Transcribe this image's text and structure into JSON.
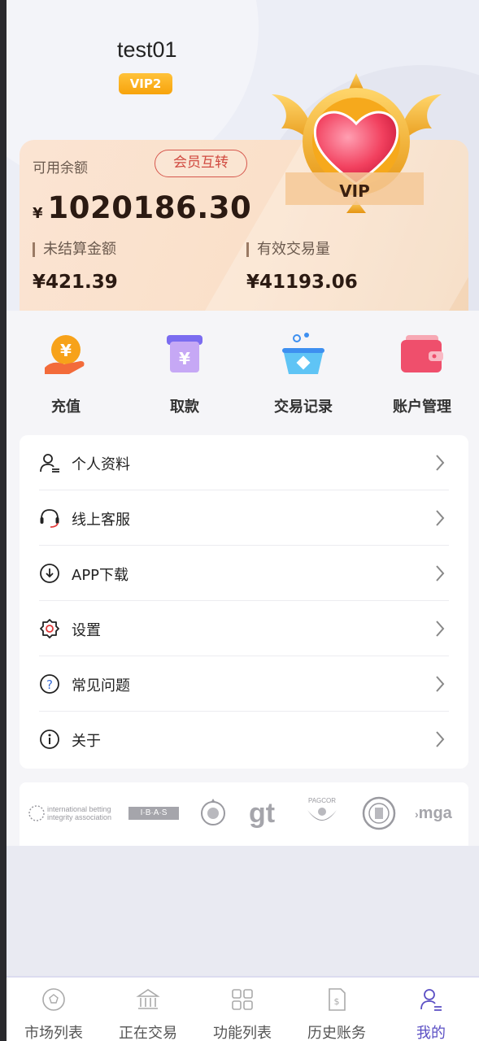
{
  "user": {
    "name": "test01",
    "level_badge": "VIP2"
  },
  "emblem": {
    "label": "VIP"
  },
  "balance_card": {
    "available_label": "可用余额",
    "transfer_button": "会员互转",
    "currency": "¥",
    "available_amount": "1020186.30",
    "unsettled_label": "未结算金额",
    "unsettled_amount": "¥421.39",
    "turnover_label": "有效交易量",
    "turnover_amount": "¥41193.06"
  },
  "quick_actions": [
    {
      "label": "充值",
      "icon": "coin-hand-icon"
    },
    {
      "label": "取款",
      "icon": "withdraw-box-icon"
    },
    {
      "label": "交易记录",
      "icon": "basket-icon"
    },
    {
      "label": "账户管理",
      "icon": "wallet-icon"
    }
  ],
  "menu": [
    {
      "label": "个人资料",
      "icon": "user-profile-icon"
    },
    {
      "label": "线上客服",
      "icon": "headset-icon"
    },
    {
      "label": "APP下载",
      "icon": "download-icon"
    },
    {
      "label": "设置",
      "icon": "gear-icon"
    },
    {
      "label": "常见问题",
      "icon": "question-icon"
    },
    {
      "label": "关于",
      "icon": "info-icon"
    }
  ],
  "partner_logos": {
    "ibia_line1": "international betting",
    "ibia_line2": "integrity association",
    "ibas": "I·B·A·S",
    "gt": "gt",
    "pagcor": "PAGCOR",
    "mga": "mga"
  },
  "tabs": [
    {
      "label": "市场列表",
      "icon": "football-icon"
    },
    {
      "label": "正在交易",
      "icon": "bank-icon"
    },
    {
      "label": "功能列表",
      "icon": "grid-icon"
    },
    {
      "label": "历史账务",
      "icon": "bill-icon"
    },
    {
      "label": "我的",
      "icon": "profile-icon",
      "active": true
    }
  ],
  "colors": {
    "accent": "#5b4fc4",
    "badge": "#f7a30c",
    "transfer": "#d04a40"
  }
}
